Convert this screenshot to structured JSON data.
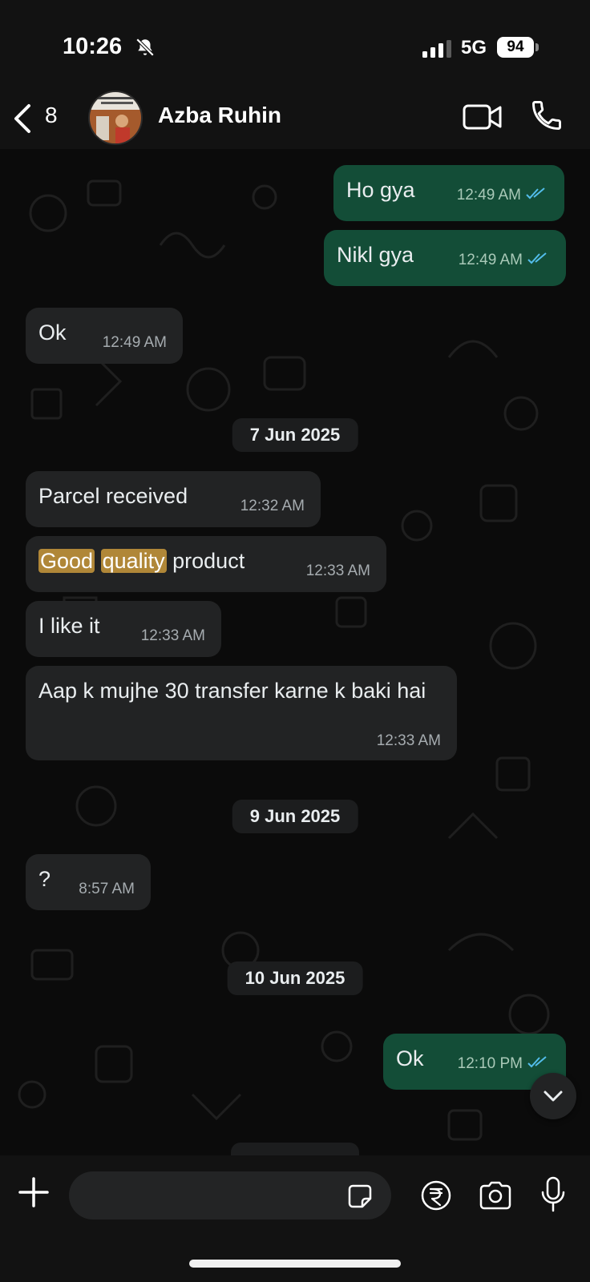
{
  "status_bar": {
    "time": "10:26",
    "network": "5G",
    "battery": "94"
  },
  "header": {
    "back_count": "8",
    "contact_name": "Azba Ruhin"
  },
  "messages": [
    {
      "dir": "out",
      "text": "Ho gya",
      "time": "12:49 AM"
    },
    {
      "dir": "out",
      "text": "Nikl gya",
      "time": "12:49 AM"
    },
    {
      "dir": "in",
      "text": "Ok",
      "time": "12:49 AM"
    },
    {
      "date": "7 Jun 2025"
    },
    {
      "dir": "in",
      "text": "Parcel received",
      "time": "12:32 AM"
    },
    {
      "dir": "in",
      "text_parts": [
        "Good",
        "quality",
        "product"
      ],
      "time": "12:33 AM"
    },
    {
      "dir": "in",
      "text": "I like it",
      "time": "12:33 AM"
    },
    {
      "dir": "in",
      "text": "Aap k mujhe 30 transfer karne k baki hai",
      "time": "12:33 AM"
    },
    {
      "date": "9 Jun 2025"
    },
    {
      "dir": "in",
      "text": "?",
      "time": "8:57 AM"
    },
    {
      "date": "10 Jun 2025"
    },
    {
      "dir": "out",
      "text": "Ok",
      "time": "12:10 PM"
    }
  ],
  "input": {
    "placeholder": "",
    "value": ""
  },
  "colors": {
    "outgoing_bubble": "#134d37",
    "incoming_bubble": "#222324",
    "highlight": "#b08738",
    "read_ticks": "#53bdeb"
  }
}
